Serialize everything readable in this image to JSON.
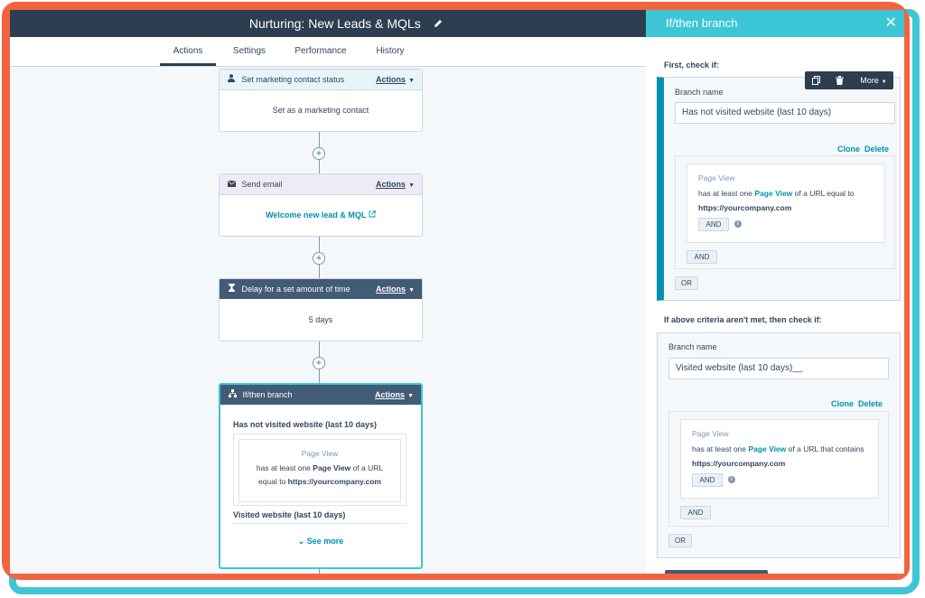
{
  "header": {
    "title": "Nurturing: New Leads & MQLs"
  },
  "tabs": [
    {
      "label": "Actions",
      "active": true
    },
    {
      "label": "Settings",
      "active": false
    },
    {
      "label": "Performance",
      "active": false
    },
    {
      "label": "History",
      "active": false
    }
  ],
  "workflow": {
    "plus_label": "+",
    "actions_label": "Actions",
    "cards": [
      {
        "icon": "person-icon",
        "title": "Set marketing contact status",
        "body": "Set as a marketing contact"
      },
      {
        "icon": "envelope-icon",
        "title": "Send email",
        "body": "Welcome new lead & MQL"
      },
      {
        "icon": "hourglass-icon",
        "title": "Delay for a set amount of time",
        "body": "5 days"
      },
      {
        "icon": "branch-icon",
        "title": "If/then branch",
        "branch1_name": "Has not visited website (last 10 days)",
        "criteria_title": "Page View",
        "criteria_line1_pre": "has at least one",
        "criteria_line1_link": "Page View",
        "criteria_line1_post": "of a URL",
        "criteria_line2_pre": "equal to",
        "criteria_line2_url": "https://yourcompany.com",
        "branch2_name": "Visited website (last 10 days)",
        "see_more": "See more"
      }
    ]
  },
  "toolbar": {
    "more_label": "More"
  },
  "panel": {
    "title": "If/then branch",
    "first_check_label": "First, check if:",
    "else_check_label": "If above criteria aren't met, then check if:",
    "branch_name_label": "Branch name",
    "clone_label": "Clone",
    "delete_label": "Delete",
    "and_label": "AND",
    "or_label": "OR",
    "branches": [
      {
        "name": "Has not visited website (last 10 days)",
        "criteria_title": "Page View",
        "line1_pre": "has at least one",
        "line1_link": "Page View",
        "line1_post": "of a URL equal to",
        "url": "https://yourcompany.com"
      },
      {
        "name": "Visited website (last 10 days)__",
        "criteria_title": "Page View",
        "line1_pre": "has at least one",
        "line1_link": "Page View",
        "line1_post": "of a URL that contains",
        "url": "https://yourcompany.com"
      }
    ]
  },
  "colors": {
    "header_dark": "#2d3e50",
    "accent_teal": "#3cc6d6",
    "link_blue": "#0091ae",
    "frame_orange": "#f2633f"
  }
}
